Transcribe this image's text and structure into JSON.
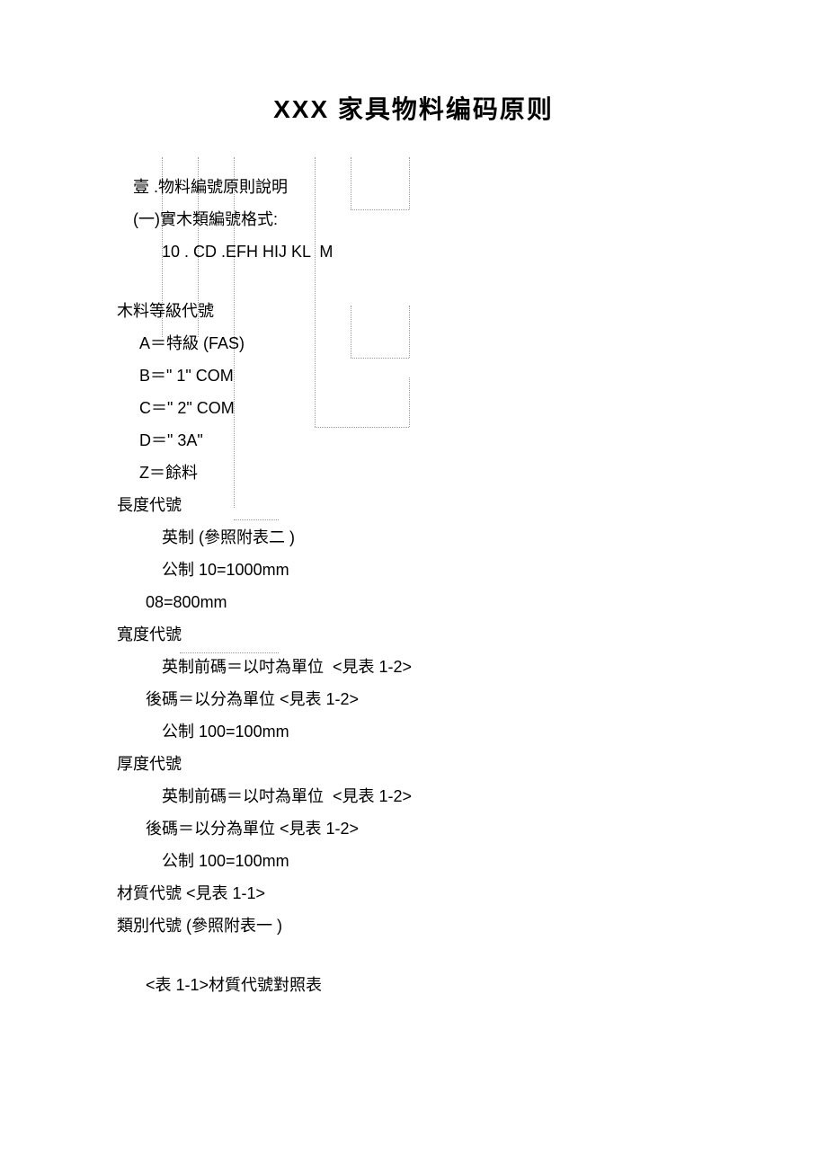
{
  "title": "XXX  家具物料编码原则",
  "heading1": "壹 .物料編號原則說明",
  "sub1": "(一)實木類編號格式:",
  "codeLine": "10 . CD .EFH HIJ KL  M",
  "grade": {
    "heading": "木料等級代號",
    "a": "A＝特級 (FAS)",
    "b": "B＝\" 1\" COM",
    "c": "C＝\" 2\" COM",
    "d": "D＝\" 3A\"",
    "z": "Z＝餘料"
  },
  "length": {
    "heading": "長度代號",
    "l1": "英制 (參照附表二 )",
    "l2": "公制 10=1000mm",
    "l3": "08=800mm"
  },
  "width": {
    "heading": "寬度代號",
    "w1": "英制前碼＝以吋為單位  <見表 1-2>",
    "w2": "後碼＝以分為單位 <見表 1-2>",
    "w3": "公制 100=100mm"
  },
  "thickness": {
    "heading": "厚度代號",
    "t1": "英制前碼＝以吋為單位  <見表 1-2>",
    "t2": "後碼＝以分為單位 <見表 1-2>",
    "t3": "公制 100=100mm"
  },
  "material": "材質代號 <見表 1-1>",
  "category": "類別代號 (參照附表一 )",
  "tableTitle": "<表 1-1>材質代號對照表"
}
